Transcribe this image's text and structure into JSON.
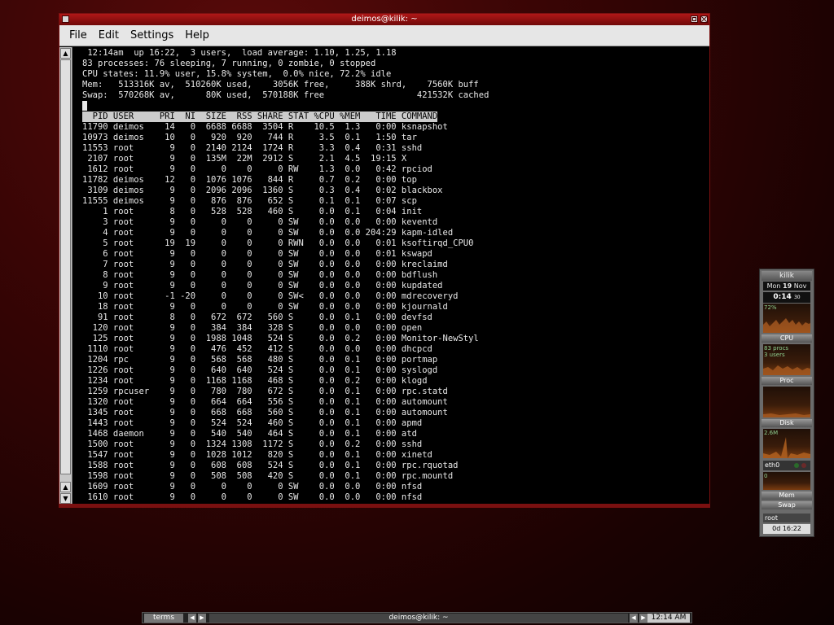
{
  "window": {
    "title": "deimos@kilik: ~"
  },
  "menu": [
    "File",
    "Edit",
    "Settings",
    "Help"
  ],
  "terminal": {
    "summary": [
      " 12:14am  up 16:22,  3 users,  load average: 1.10, 1.25, 1.18",
      "83 processes: 76 sleeping, 7 running, 0 zombie, 0 stopped",
      "CPU states: 11.9% user, 15.8% system,  0.0% nice, 72.2% idle",
      "Mem:   513316K av,  510260K used,    3056K free,     388K shrd,    7560K buff",
      "Swap:  570268K av,      80K used,  570188K free                  421532K cached"
    ],
    "header": "  PID USER     PRI  NI  SIZE  RSS SHARE STAT %CPU %MEM   TIME COMMAND",
    "processes": [
      "11790 deimos    14   0  6688 6688  3504 R    10.5  1.3   0:00 ksnapshot",
      "10973 deimos    10   0   920  920   744 R     3.5  0.1   1:50 tar",
      "11553 root       9   0  2140 2124  1724 R     3.3  0.4   0:31 sshd",
      " 2107 root       9   0  135M  22M  2912 S     2.1  4.5  19:15 X",
      " 1612 root       9   0     0    0     0 RW    1.3  0.0   0:42 rpciod",
      "11782 deimos    12   0  1076 1076   844 R     0.7  0.2   0:00 top",
      " 3109 deimos     9   0  2096 2096  1360 S     0.3  0.4   0:02 blackbox",
      "11555 deimos     9   0   876  876   652 S     0.1  0.1   0:07 scp",
      "    1 root       8   0   528  528   460 S     0.0  0.1   0:04 init",
      "    3 root       9   0     0    0     0 SW    0.0  0.0   0:00 keventd",
      "    4 root       9   0     0    0     0 SW    0.0  0.0 204:29 kapm-idled",
      "    5 root      19  19     0    0     0 RWN   0.0  0.0   0:01 ksoftirqd_CPU0",
      "    6 root       9   0     0    0     0 SW    0.0  0.0   0:01 kswapd",
      "    7 root       9   0     0    0     0 SW    0.0  0.0   0:00 kreclaimd",
      "    8 root       9   0     0    0     0 SW    0.0  0.0   0:00 bdflush",
      "    9 root       9   0     0    0     0 SW    0.0  0.0   0:00 kupdated",
      "   10 root      -1 -20     0    0     0 SW<   0.0  0.0   0:00 mdrecoveryd",
      "   18 root       9   0     0    0     0 SW    0.0  0.0   0:00 kjournald",
      "   91 root       8   0   672  672   560 S     0.0  0.1   0:00 devfsd",
      "  120 root       9   0   384  384   328 S     0.0  0.0   0:00 open",
      "  125 root       9   0  1988 1048   524 S     0.0  0.2   0:00 Monitor-NewStyl",
      " 1110 root       9   0   476  452   412 S     0.0  0.0   0:00 dhcpcd",
      " 1204 rpc        9   0   568  568   480 S     0.0  0.1   0:00 portmap",
      " 1226 root       9   0   640  640   524 S     0.0  0.1   0:00 syslogd",
      " 1234 root       9   0  1168 1168   468 S     0.0  0.2   0:00 klogd",
      " 1259 rpcuser    9   0   780  780   672 S     0.0  0.1   0:00 rpc.statd",
      " 1320 root       9   0   664  664   556 S     0.0  0.1   0:00 automount",
      " 1345 root       9   0   668  668   560 S     0.0  0.1   0:00 automount",
      " 1443 root       9   0   524  524   460 S     0.0  0.1   0:00 apmd",
      " 1468 daemon     9   0   540  540   464 S     0.0  0.1   0:00 atd",
      " 1500 root       9   0  1324 1308  1172 S     0.0  0.2   0:00 sshd",
      " 1547 root       9   0  1028 1012   820 S     0.0  0.1   0:00 xinetd",
      " 1588 root       9   0   608  608   524 S     0.0  0.1   0:00 rpc.rquotad",
      " 1598 root       9   0   508  508   420 S     0.0  0.1   0:00 rpc.mountd",
      " 1609 root       9   0     0    0     0 SW    0.0  0.0   0:00 nfsd",
      " 1610 root       9   0     0    0     0 SW    0.0  0.0   0:00 nfsd"
    ]
  },
  "gkrellm": {
    "hostname": "kilik",
    "date_day": "Mon",
    "date_num": "19",
    "date_month": "Nov",
    "time": "0:14",
    "seconds": "30",
    "cpu_percent": "72%",
    "cpu_label": "CPU",
    "procs_text": "83 procs",
    "users_text": "3 users",
    "proc_label": "Proc",
    "disk_label": "Disk",
    "disk_rate": "2.6M",
    "eth_label": "eth0",
    "eth_value": "0",
    "mem_label": "Mem",
    "swap_label": "Swap",
    "user_label": "root",
    "uptime": "0d 16:22"
  },
  "taskbar": {
    "workspace": "terms",
    "window_title": "deimos@kilik: ~",
    "clock": "12:14 AM"
  }
}
